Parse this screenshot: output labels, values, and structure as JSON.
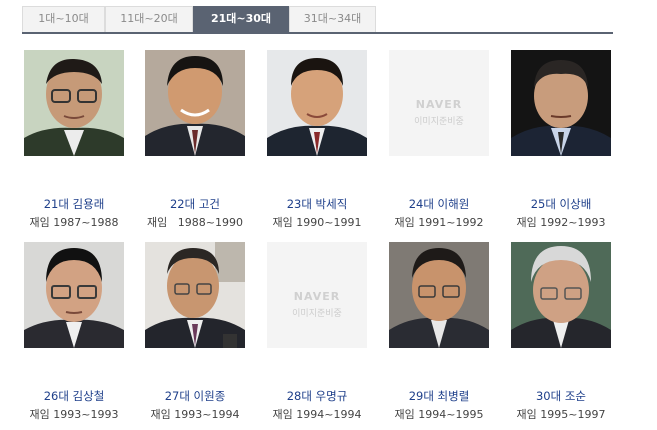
{
  "tabs": [
    {
      "label": "1대~10대",
      "active": false
    },
    {
      "label": "11대~20대",
      "active": false
    },
    {
      "label": "21대~30대",
      "active": true
    },
    {
      "label": "31대~34대",
      "active": false
    }
  ],
  "placeholder": {
    "logo": "NAVER",
    "caption": "이미지준비중"
  },
  "ministers": [
    {
      "name": "21대 김용래",
      "term": "재임 1987~1988"
    },
    {
      "name": "22대 고건",
      "term": "재임   1988~1990"
    },
    {
      "name": "23대 박세직",
      "term": "재임 1990~1991"
    },
    {
      "name": "24대 이해원",
      "term": "재임 1991~1992"
    },
    {
      "name": "25대 이상배",
      "term": "재임 1992~1993"
    },
    {
      "name": "26대 김상철",
      "term": "재임 1993~1993"
    },
    {
      "name": "27대 이원종",
      "term": "재임 1993~1994"
    },
    {
      "name": "28대 우명규",
      "term": "재임 1994~1994"
    },
    {
      "name": "29대 최병렬",
      "term": "재임 1994~1995"
    },
    {
      "name": "30대 조순",
      "term": "재임 1995~1997"
    }
  ]
}
